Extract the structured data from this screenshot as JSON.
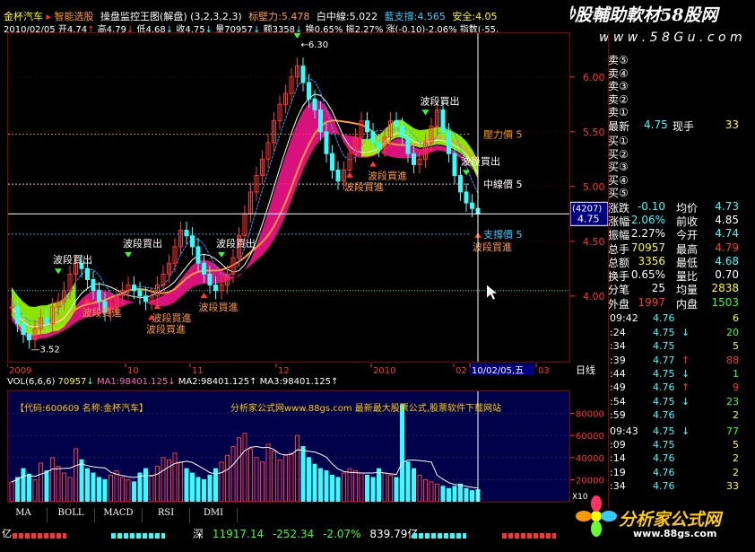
{
  "header": {
    "stock_name": "金杯汽车",
    "indicator_name": "智能选股",
    "formula_title": "操盘监控王图(解盘)",
    "formula_params": "(3,2,3,2,3)",
    "pressure_label": "标壁力",
    "pressure_value": "5.478",
    "middle_label": "白中線",
    "middle_value": "5.022",
    "support_label": "藍支撐",
    "support_value": "4.565",
    "safe_label": "安全",
    "safe_value": "4.05",
    "date": "2010/02/05",
    "open": "开4.74",
    "high": "高4.79",
    "low": "低4.68",
    "close": "收4.75",
    "volume": "量70957",
    "amount": "额3358",
    "turnover": "换0.65%",
    "amplitude": "振2.27%",
    "change": "涨(-0.10)-2.06%",
    "index": "指数(-55."
  },
  "watermark": {
    "text": "炒股輔助軟材58股网",
    "url": "w w w . 5 8 G u . c o m"
  },
  "chart_data": {
    "type": "candlestick",
    "price_axis_ticks": [
      "6.00",
      "5.50",
      "5.00",
      "4.50",
      "4.00"
    ],
    "ylim": [
      3.4,
      6.4
    ],
    "date_axis_labels": [
      "2009",
      "10",
      "11",
      "12",
      "2010",
      "02",
      "10/02/05,五",
      "03"
    ],
    "period_label": "日线",
    "high_marker": "6.30",
    "low_marker": "3.52",
    "levels": [
      {
        "label": "壓力價 5",
        "value": 5.478,
        "color": "#ff9900"
      },
      {
        "label": "中線價 5",
        "value": 5.022,
        "color": "#ffffff"
      },
      {
        "label": "支撐價 5",
        "value": 4.565,
        "color": "#33ccff"
      }
    ],
    "current_price": "4.75",
    "current_count": "(4207)",
    "signals": [
      {
        "text": "波段買出",
        "kind": "sell"
      },
      {
        "text": "波段買進",
        "kind": "buy"
      },
      {
        "text": "波段買出",
        "kind": "sell"
      },
      {
        "text": "波段買進",
        "kind": "buy"
      },
      {
        "text": "波段買出",
        "kind": "sell"
      },
      {
        "text": "波段買進",
        "kind": "buy"
      },
      {
        "text": "波段買出",
        "kind": "sell"
      },
      {
        "text": "波段買進",
        "kind": "buy"
      },
      {
        "text": "波段買出",
        "kind": "sell"
      },
      {
        "text": "波段買出",
        "kind": "sell"
      },
      {
        "text": "波段買進",
        "kind": "buy"
      },
      {
        "text": "波段買進",
        "kind": "buy"
      },
      {
        "text": "波段買進",
        "kind": "buy"
      }
    ],
    "closes": [
      3.9,
      3.75,
      3.65,
      3.6,
      3.7,
      3.8,
      3.75,
      3.9,
      3.95,
      4.05,
      4.2,
      4.3,
      4.25,
      4.15,
      4.05,
      3.95,
      3.85,
      3.9,
      4.0,
      4.05,
      4.1,
      4.05,
      4.0,
      3.95,
      4.0,
      4.1,
      4.2,
      4.3,
      4.45,
      4.6,
      4.55,
      4.45,
      4.3,
      4.2,
      4.1,
      4.05,
      4.1,
      4.2,
      4.35,
      4.55,
      4.75,
      4.95,
      5.1,
      5.25,
      5.4,
      5.6,
      5.75,
      5.85,
      6.0,
      6.1,
      5.95,
      5.8,
      5.7,
      5.5,
      5.3,
      5.15,
      5.05,
      5.15,
      5.3,
      5.45,
      5.6,
      5.5,
      5.4,
      5.35,
      5.45,
      5.6,
      5.55,
      5.45,
      5.3,
      5.2,
      5.25,
      5.4,
      5.55,
      5.7,
      5.5,
      5.3,
      5.1,
      4.95,
      4.85,
      4.8,
      4.75
    ],
    "volume": {
      "header": "VOL(6,6,6)",
      "value": "70957",
      "ma1": "MA1:98401.125",
      "ma2": "MA2:98401.125",
      "ma3": "MA3:98401.125",
      "axis_ticks": [
        "80000",
        "60000",
        "40000",
        "20000"
      ],
      "ylim": [
        0,
        100000
      ],
      "axis_unit": "X10",
      "code_line": "【代码:600609 名称:金杯汽车】",
      "ad_line": "分析家公式网www.88gs.com 最新最大股票公式,股票软件下载网站",
      "bars": [
        18000,
        22000,
        30000,
        25000,
        20000,
        35000,
        28000,
        40000,
        32000,
        26000,
        22000,
        48000,
        38000,
        30000,
        26000,
        22000,
        20000,
        24000,
        28000,
        22000,
        20000,
        18000,
        26000,
        30000,
        24000,
        32000,
        40000,
        38000,
        44000,
        36000,
        30000,
        26000,
        22000,
        20000,
        24000,
        30000,
        36000,
        42000,
        50000,
        58000,
        62000,
        48000,
        40000,
        36000,
        52000,
        46000,
        38000,
        42000,
        44000,
        60000,
        50000,
        40000,
        34000,
        30000,
        28000,
        24000,
        22000,
        26000,
        30000,
        28000,
        26000,
        24000,
        22000,
        30000,
        26000,
        24000,
        22000,
        88000,
        36000,
        30000,
        24000,
        20000,
        18000,
        16000,
        14000,
        12000,
        14000,
        16000,
        12000,
        10000,
        11000
      ]
    }
  },
  "tabs": [
    "MA",
    "BOLL",
    "MACD",
    "RSI",
    "DMI"
  ],
  "quote_panel": {
    "asks": [
      "卖⑤",
      "卖④",
      "卖③",
      "卖②",
      "卖①"
    ],
    "latest_label": "最新",
    "latest_value": "4.75",
    "latest_hand_label": "现手",
    "latest_hand_value": "33",
    "bids": [
      "买①",
      "买②",
      "买③",
      "买④",
      "买⑤"
    ],
    "stats": [
      {
        "l1": "涨跌",
        "v1": "-0.10",
        "l2": "均价",
        "v2": "4.73"
      },
      {
        "l1": "涨幅",
        "v1": "-2.06%",
        "l2": "前收",
        "v2": "4.85"
      },
      {
        "l1": "振幅",
        "v1": "2.27%",
        "l2": "今开",
        "v2": "4.74"
      },
      {
        "l1": "总手",
        "v1": "70957",
        "l2": "最高",
        "v2": "4.79"
      },
      {
        "l1": "总额",
        "v1": "3356",
        "l2": "最低",
        "v2": "4.68"
      },
      {
        "l1": "换手",
        "v1": "0.65%",
        "l2": "量比",
        "v2": "0.70"
      },
      {
        "l1": "分笔",
        "v1": "25",
        "l2": "均量",
        "v2": "2838"
      }
    ],
    "outer_label": "外盘",
    "outer_value": "1997",
    "inner_label": "内盘",
    "inner_value": "1503",
    "ticks": [
      {
        "t": "09:42",
        "p": "4.76",
        "a": "",
        "v": "6"
      },
      {
        "t": ":24",
        "p": "4.75",
        "a": "↓",
        "v": "20"
      },
      {
        "t": ":34",
        "p": "4.75",
        "a": "",
        "v": "5"
      },
      {
        "t": ":39",
        "p": "4.77",
        "a": "↑",
        "v": "88"
      },
      {
        "t": ":44",
        "p": "4.75",
        "a": "↓",
        "v": "1"
      },
      {
        "t": ":49",
        "p": "4.76",
        "a": "↑",
        "v": "9"
      },
      {
        "t": ":54",
        "p": "4.75",
        "a": "↓",
        "v": "23"
      },
      {
        "t": ":59",
        "p": "4.76",
        "a": "",
        "v": "2"
      },
      {
        "t": "09:43",
        "p": "4.75",
        "a": "↓",
        "v": "77"
      },
      {
        "t": ":09",
        "p": "4.75",
        "a": "",
        "v": "5"
      },
      {
        "t": ":14",
        "p": "4.76",
        "a": "",
        "v": "2"
      },
      {
        "t": ":19",
        "p": "4.76",
        "a": "",
        "v": "2"
      },
      {
        "t": ":34",
        "p": "4.76",
        "a": "",
        "v": "33"
      }
    ]
  },
  "status": {
    "left_label": "亿",
    "index_name": "深",
    "index_value": "11917.14",
    "index_change": "-252.34",
    "index_pct": "-2.07%",
    "index_amount": "839.79亿"
  },
  "logo": {
    "text": "分析家公式网",
    "url": "www.88gs.com"
  },
  "colors": {
    "up": "#ff3333",
    "down": "#33ffff",
    "band_pink": "#ff1493",
    "band_green": "#99ff00",
    "ma_orange": "#ff9933"
  }
}
